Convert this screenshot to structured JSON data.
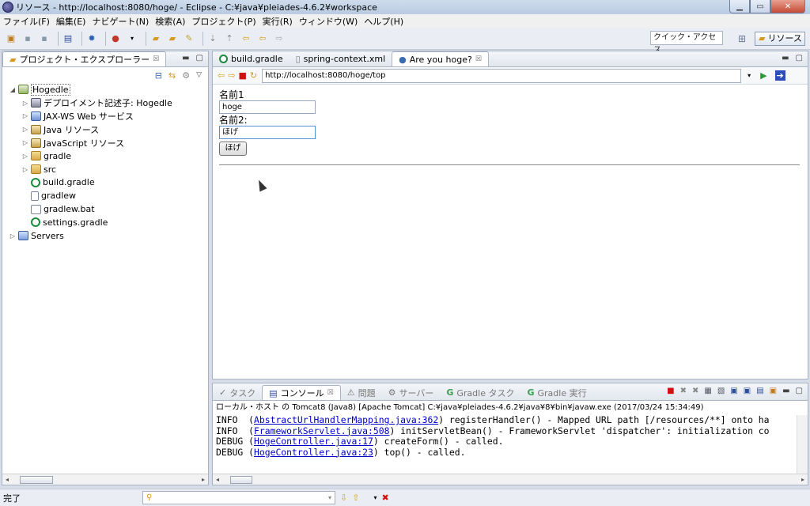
{
  "window": {
    "title": "リソース - http://localhost:8080/hoge/ - Eclipse - C:¥java¥pleiades-4.6.2¥workspace"
  },
  "menu": [
    "ファイル(F)",
    "編集(E)",
    "ナビゲート(N)",
    "検索(A)",
    "プロジェクト(P)",
    "実行(R)",
    "ウィンドウ(W)",
    "ヘルプ(H)"
  ],
  "toolbar": {
    "quick_access": "クイック・アクセス",
    "perspective": "リソース"
  },
  "explorer": {
    "tab_label": "プロジェクト・エクスプローラー",
    "tree": [
      {
        "label": "Hogedle",
        "icon": "project-icon",
        "indent": 0,
        "expanded": true
      },
      {
        "label": "デプロイメント記述子: Hogedle",
        "icon": "deploy-icon",
        "indent": 1
      },
      {
        "label": "JAX-WS Web サービス",
        "icon": "webservice-icon",
        "indent": 1
      },
      {
        "label": "Java リソース",
        "icon": "java-resource-icon",
        "indent": 1
      },
      {
        "label": "JavaScript リソース",
        "icon": "js-resource-icon",
        "indent": 1
      },
      {
        "label": "gradle",
        "icon": "folder-icon",
        "indent": 1
      },
      {
        "label": "src",
        "icon": "folder-icon",
        "indent": 1
      },
      {
        "label": "build.gradle",
        "icon": "gradle-icon",
        "indent": 1
      },
      {
        "label": "gradlew",
        "icon": "file-icon",
        "indent": 1
      },
      {
        "label": "gradlew.bat",
        "icon": "file-icon",
        "indent": 1
      },
      {
        "label": "settings.gradle",
        "icon": "gradle-icon",
        "indent": 1
      },
      {
        "label": "Servers",
        "icon": "folder-icon",
        "indent": 0
      }
    ]
  },
  "editor": {
    "tabs": [
      "build.gradle",
      "spring-context.xml",
      "Are you hoge?"
    ],
    "url": "http://localhost:8080/hoge/top",
    "page": {
      "label1": "名前1",
      "value1": "hoge",
      "label2": "名前2:",
      "value2": "ほげ",
      "button": "ほげ"
    }
  },
  "console": {
    "tabs": [
      "タスク",
      "コンソール",
      "問題",
      "サーバー",
      "Gradle タスク",
      "Gradle 実行"
    ],
    "header": "ローカル・ホスト の Tomcat8 (Java8) [Apache Tomcat] C:¥java¥pleiades-4.6.2¥java¥8¥bin¥javaw.exe (2017/03/24 15:34:49)",
    "lines": [
      {
        "pre": "INFO  (",
        "link": "AbstractUrlHandlerMapping.java:362",
        "post": ") registerHandler() - Mapped URL path [/resources/**] onto ha"
      },
      {
        "pre": "INFO  (",
        "link": "FrameworkServlet.java:508",
        "post": ") initServletBean() - FrameworkServlet 'dispatcher': initialization co"
      },
      {
        "pre": "DEBUG (",
        "link": "HogeController.java:17",
        "post": ") createForm() - called."
      },
      {
        "pre": "DEBUG (",
        "link": "HogeController.java:23",
        "post": ") top() - called."
      }
    ]
  },
  "status": {
    "text": "完了"
  }
}
